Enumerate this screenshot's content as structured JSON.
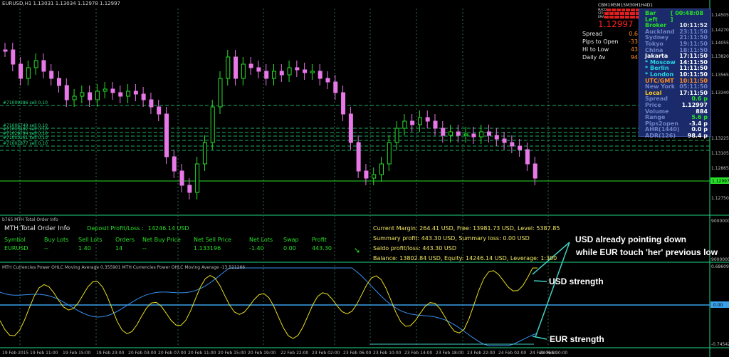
{
  "chart": {
    "title": "EURUSD,H1  1.13031 1.13034 1.12978 1.12997",
    "price_badge": "1.12997",
    "bottom_badge": "0.00",
    "yaxis_main": [
      "1.14505",
      "1.14270",
      "1.14055",
      "1.13820",
      "1.13565",
      "1.13340",
      "1.13225",
      "1.13105",
      "1.12865",
      "1.12750"
    ],
    "yaxis_orders": [
      "9000000",
      "9000000"
    ],
    "yaxis_ind": [
      "0.686099",
      "-0.745428"
    ],
    "xaxis": [
      "19 Feb 2015",
      "19 Feb 11:00",
      "19 Feb 15:00",
      "19 Feb 23:00",
      "20 Feb 03:00",
      "20 Feb 07:00",
      "20 Feb 11:00",
      "20 Feb 15:00",
      "20 Feb 19:00",
      "22 Feb 22:00",
      "23 Feb 02:00",
      "23 Feb 06:00",
      "23 Feb 10:00",
      "23 Feb 14:00",
      "23 Feb 18:00",
      "23 Feb 22:00",
      "24 Feb 02:00",
      "24 Feb 06:00",
      "24 Feb 10:00"
    ],
    "order_levels": [
      "#71009286 sell 0.10",
      "#71006749 sell 0.10",
      "#71005492 sell 0.10",
      "#71029794 sell 0.10",
      "#71003261 sell 0.10",
      "#71002877 sell 0.10"
    ]
  },
  "timeframes": [
    "CB",
    "M1",
    "M5",
    "M15",
    "M30",
    "H1",
    "H4",
    "D1"
  ],
  "tf_rows": [
    "MACD",
    "STR",
    "EMA"
  ],
  "stats": {
    "price": "1.12997",
    "rows": [
      {
        "label": "Spread",
        "value": "0.6"
      },
      {
        "label": "Pips to Open",
        "value": "-33"
      },
      {
        "label": "Hi to Low",
        "value": "43"
      },
      {
        "label": "Daily Av",
        "value": "94"
      }
    ]
  },
  "world": {
    "rows": [
      {
        "label": "Bar Left",
        "value": "[ 00:48:08 ]",
        "lc": "#28e028",
        "vc": "#28e028"
      },
      {
        "label": "Broker",
        "value": "10:11:52",
        "lc": "#28e028",
        "vc": "#e8e8e8"
      },
      {
        "label": "Auckland",
        "value": "23:11:50",
        "lc": "#6f82c8",
        "vc": "#6f82c8"
      },
      {
        "label": "Sydney",
        "value": "21:11:50",
        "lc": "#6f82c8",
        "vc": "#6f82c8"
      },
      {
        "label": "Tokyo",
        "value": "19:11:50",
        "lc": "#6f82c8",
        "vc": "#6f82c8"
      },
      {
        "label": "China",
        "value": "18:11:50",
        "lc": "#6f82c8",
        "vc": "#6f82c8"
      },
      {
        "label": "Jakarta",
        "value": "17:11:50",
        "lc": "#ffffff",
        "vc": "#ffffff"
      },
      {
        "label": "* Moscow",
        "value": "14:11:50",
        "lc": "#28d8e8",
        "vc": "#ffffff"
      },
      {
        "label": "* Berlin",
        "value": "11:11:50",
        "lc": "#28d8e8",
        "vc": "#ffffff"
      },
      {
        "label": "* London",
        "value": "10:11:50",
        "lc": "#28d8e8",
        "vc": "#ffffff"
      },
      {
        "label": "UTC/GMT",
        "value": "10:11:50",
        "lc": "#ff8c20",
        "vc": "#ff8c20"
      },
      {
        "label": "New York",
        "value": "05:11:50",
        "lc": "#6f82c8",
        "vc": "#6f82c8"
      },
      {
        "label": "Local",
        "value": "17:11:50",
        "lc": "#ffd020",
        "vc": "#ffffff"
      },
      {
        "label": "Spread",
        "value": "0.6 p",
        "lc": "#6f82c8",
        "vc": "#28e028"
      },
      {
        "label": "Price",
        "value": "1.12997",
        "lc": "#6f82c8",
        "vc": "#ffffff"
      },
      {
        "label": "Volume",
        "value": "884",
        "lc": "#6f82c8",
        "vc": "#ffffff"
      },
      {
        "label": "Range",
        "value": "5.6 p",
        "lc": "#6f82c8",
        "vc": "#28e028"
      },
      {
        "label": "Pips2open",
        "value": "-3.4 p",
        "lc": "#6f82c8",
        "vc": "#ffffff"
      },
      {
        "label": "AHR(1440)",
        "value": "0.0 p",
        "lc": "#6f82c8",
        "vc": "#ffffff"
      },
      {
        "label": "ADR(126)",
        "value": "98.4 p",
        "lc": "#6f82c8",
        "vc": "#ffffff"
      }
    ]
  },
  "orders_panel": {
    "label": "b765 MTH Total Order Info",
    "heading": "MTH Total Order Info",
    "deposit_label": "Deposit Profit/Loss :",
    "deposit_value": "14246.14 USD",
    "headers": [
      "Symbol",
      "Buy Lots",
      "Sell Lots",
      "Orders",
      "Net Buy Price",
      "Net Sell Price",
      "Net Lots",
      "Swap",
      "Profit"
    ],
    "row": [
      "EURUSD",
      "--",
      "1.40",
      "14",
      "--",
      "1.133196",
      "-1.40",
      "0.00",
      "443.30"
    ],
    "arrow": "➘",
    "account": [
      "Current Margin: 264.41 USD, Free: 13981.73 USD, Level: 5387.85",
      "Summary profit: 443.30 USD, Summary loss: 0.00 USD",
      "Saldo profit/loss: 443.30 USD",
      "Balance: 13802.84 USD, Equity: 14246.14 USD, Leverage: 1:300"
    ]
  },
  "indicator": {
    "label": "MTH Currencies Power OHLC Moving Average 0.355901   MTH Currencies Power OHLC Moving Average -13.521266"
  },
  "annotations": {
    "note1": "USD already pointing down",
    "note2": "while EUR touch 'her' previous low",
    "usd": "USD strength",
    "eur": "EUR strength"
  },
  "colors": {
    "bull": "#28e028",
    "bear": "#e878e8",
    "usd_line": "#e8e020",
    "eur_line": "#3890f0",
    "accent": "#40d0c0"
  }
}
